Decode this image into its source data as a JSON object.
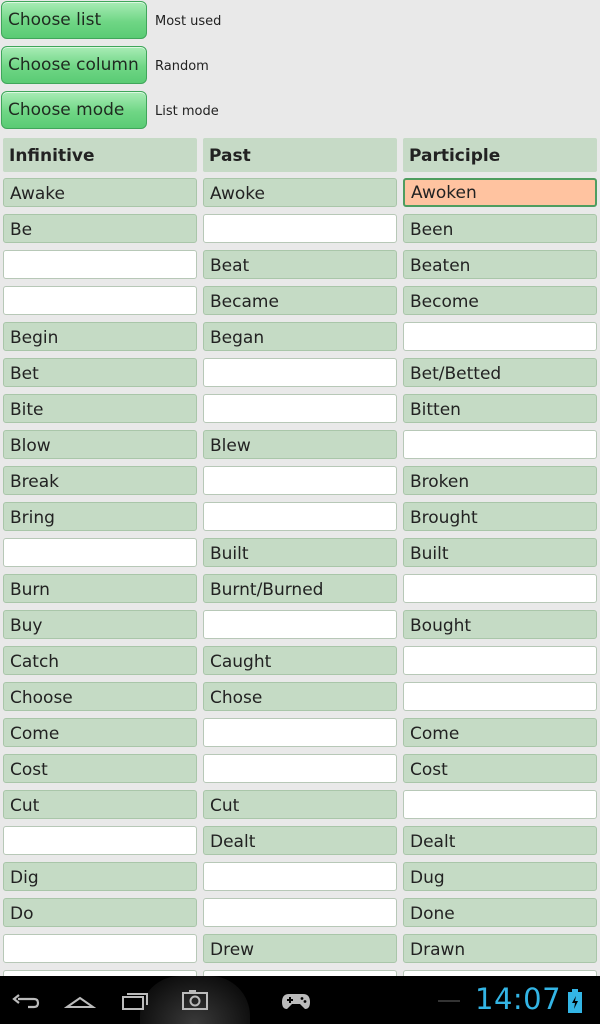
{
  "controls": [
    {
      "label": "Choose list",
      "value": "Most used"
    },
    {
      "label": "Choose column",
      "value": "Random"
    },
    {
      "label": "Choose mode",
      "value": "List mode"
    }
  ],
  "table": {
    "headers": [
      "Infinitive",
      "Past",
      "Participle"
    ],
    "rows": [
      [
        "Awake",
        "Awoke",
        "Awoken"
      ],
      [
        "Be",
        "",
        "Been"
      ],
      [
        "",
        "Beat",
        "Beaten"
      ],
      [
        "",
        "Became",
        "Become"
      ],
      [
        "Begin",
        "Began",
        ""
      ],
      [
        "Bet",
        "",
        "Bet/Betted"
      ],
      [
        "Bite",
        "",
        "Bitten"
      ],
      [
        "Blow",
        "Blew",
        ""
      ],
      [
        "Break",
        "",
        "Broken"
      ],
      [
        "Bring",
        "",
        "Brought"
      ],
      [
        "",
        "Built",
        "Built"
      ],
      [
        "Burn",
        "Burnt/Burned",
        ""
      ],
      [
        "Buy",
        "",
        "Bought"
      ],
      [
        "Catch",
        "Caught",
        ""
      ],
      [
        "Choose",
        "Chose",
        ""
      ],
      [
        "Come",
        "",
        "Come"
      ],
      [
        "Cost",
        "",
        "Cost"
      ],
      [
        "Cut",
        "Cut",
        ""
      ],
      [
        "",
        "Dealt",
        "Dealt"
      ],
      [
        "Dig",
        "",
        "Dug"
      ],
      [
        "Do",
        "",
        "Done"
      ],
      [
        "",
        "Drew",
        "Drawn"
      ],
      [
        "",
        "",
        ""
      ]
    ],
    "active_cell": {
      "row": 0,
      "col": 2
    }
  },
  "system": {
    "clock": "14:07",
    "nav_icons": [
      "back-icon",
      "home-icon",
      "recent-apps-icon",
      "screenshot-icon",
      "gamepad-icon"
    ],
    "status_icons": [
      "battery-icon"
    ],
    "clock_color": "#33b5e5"
  }
}
